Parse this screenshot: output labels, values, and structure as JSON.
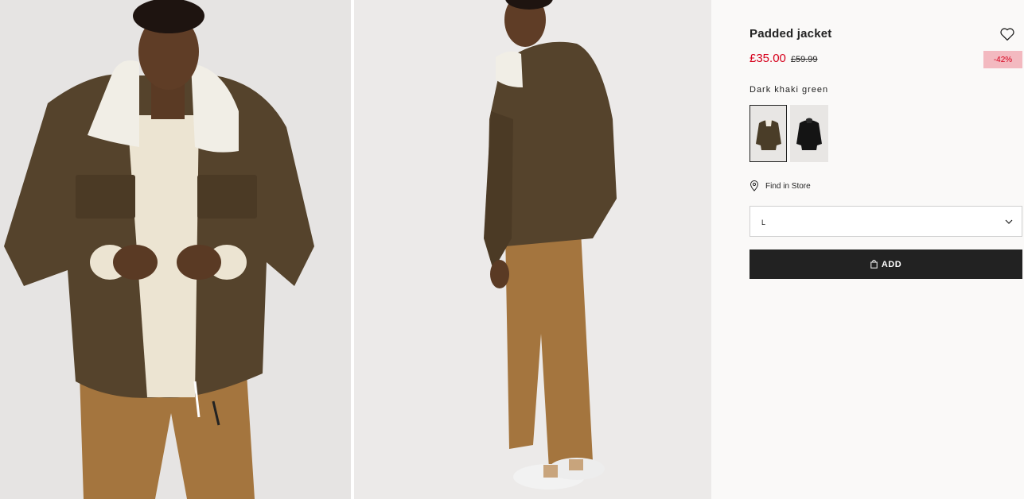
{
  "product": {
    "title": "Padded jacket",
    "price_sale": "£35.00",
    "price_original": "£59.99",
    "discount_badge": "-42%",
    "color_name": "Dark khaki green",
    "swatches": [
      {
        "icon": "jacket-khaki-thumbnail",
        "selected": true,
        "color": "#4a3d28"
      },
      {
        "icon": "jacket-black-thumbnail",
        "selected": false,
        "color": "#141414"
      }
    ]
  },
  "find_in_store": {
    "label": "Find in Store",
    "icon": "location-pin-icon"
  },
  "size_select": {
    "selected": "L",
    "icon": "chevron-down-icon"
  },
  "add_button": {
    "label": "ADD",
    "icon": "shopping-bag-icon"
  },
  "favourite": {
    "icon": "heart-icon"
  },
  "colors": {
    "sale_red": "#d6001c",
    "badge_bg": "#f3b9c0",
    "button_bg": "#222222",
    "panel_bg": "#faf9f8"
  }
}
